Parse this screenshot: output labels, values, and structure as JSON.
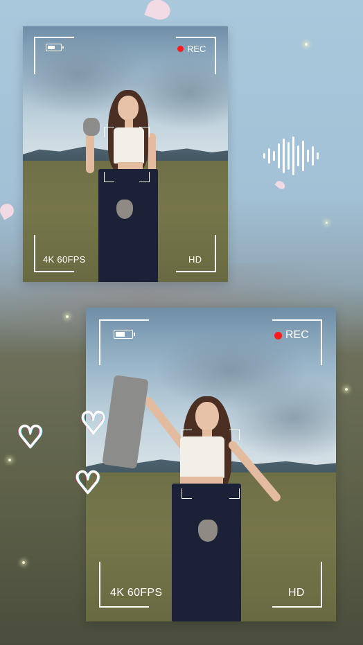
{
  "top_frame": {
    "rec_label": "REC",
    "format_label": "4K 60FPS",
    "quality_label": "HD"
  },
  "bottom_frame": {
    "rec_label": "REC",
    "format_label": "4K 60FPS",
    "quality_label": "HD"
  },
  "icons": {
    "battery": "battery-icon",
    "record_dot": "record-dot-icon",
    "sound_wave": "sound-wave-icon",
    "heart": "heart-icon",
    "petal": "flower-petal-icon"
  },
  "colors": {
    "rec_dot": "#ff1b1b",
    "viewfinder": "#ffffff"
  }
}
